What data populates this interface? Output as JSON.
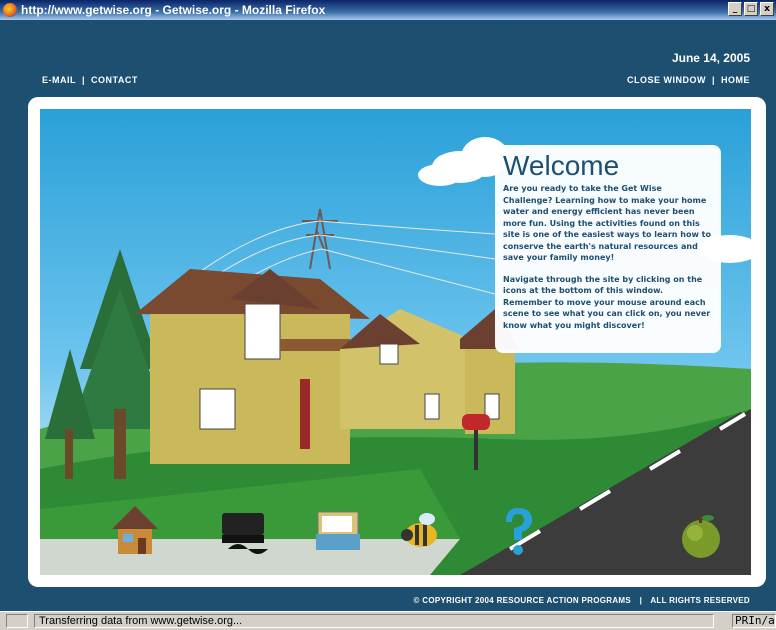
{
  "window": {
    "title": "http://www.getwise.org - Getwise.org - Mozilla Firefox",
    "buttons": {
      "minimize": "_",
      "maximize": "□",
      "close": "x"
    }
  },
  "header": {
    "date": "June 14, 2005",
    "left_links": [
      "E-MAIL",
      "CONTACT"
    ],
    "right_links": [
      "CLOSE WINDOW",
      "HOME"
    ],
    "separator": "|"
  },
  "welcome": {
    "title": "Welcome",
    "paragraphs": [
      "Are you ready to take the Get Wise Challenge? Learning how to make your home water and energy efficient has never been more fun. Using the activities found on this site is one of the easiest ways to learn how to conserve the earth's natural resources and save your family money!",
      "Navigate through the site by clicking on the icons at the bottom of this window.  Remember to move your mouse around each scene to see what you can click on, you never know what you might discover!"
    ]
  },
  "nav_icons": [
    "house-icon",
    "game-console-icon",
    "activity-kit-icon",
    "bee-icon",
    "question-mark-icon",
    "apple-icon"
  ],
  "footer": {
    "copyright": "© COPYRIGHT 2004 RESOURCE ACTION PROGRAMS",
    "rights": "ALL RIGHTS RESERVED",
    "separator": "|"
  },
  "statusbar": {
    "text": "Transferring data from www.getwise.org...",
    "right": "PRIn/a"
  },
  "colors": {
    "page_bg": "#1d4f70",
    "sky": "#2aa0d8",
    "grass": "#3a9a3a",
    "road": "#3a3a3a",
    "house": "#c9b95a",
    "roof": "#7a4a30"
  }
}
